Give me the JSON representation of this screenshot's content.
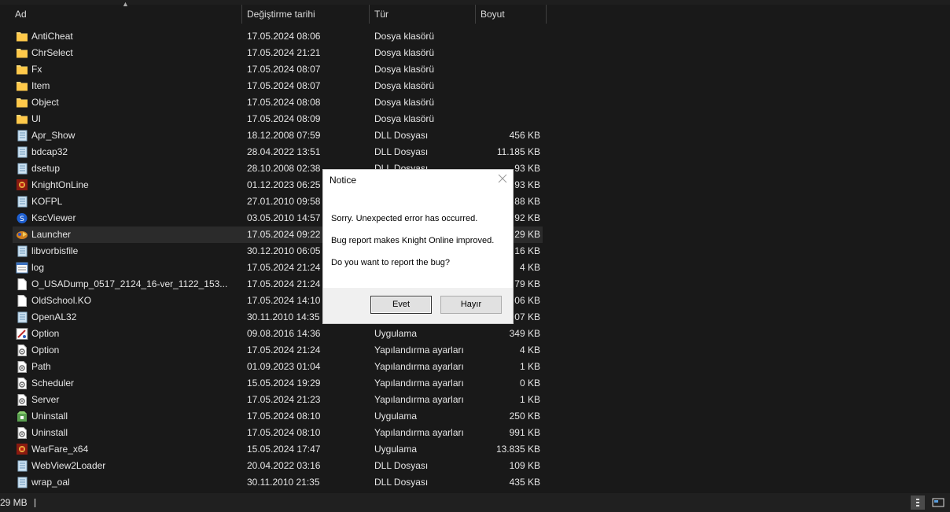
{
  "header": {
    "name": "Ad",
    "date": "Değiştirme tarihi",
    "type": "Tür",
    "size": "Boyut"
  },
  "files": [
    {
      "name": "AntiCheat",
      "date": "17.05.2024 08:06",
      "type": "Dosya klasörü",
      "size": "",
      "icon": "folder-icon"
    },
    {
      "name": "ChrSelect",
      "date": "17.05.2024 21:21",
      "type": "Dosya klasörü",
      "size": "",
      "icon": "folder-icon"
    },
    {
      "name": "Fx",
      "date": "17.05.2024 08:07",
      "type": "Dosya klasörü",
      "size": "",
      "icon": "folder-icon"
    },
    {
      "name": "Item",
      "date": "17.05.2024 08:07",
      "type": "Dosya klasörü",
      "size": "",
      "icon": "folder-icon"
    },
    {
      "name": "Object",
      "date": "17.05.2024 08:08",
      "type": "Dosya klasörü",
      "size": "",
      "icon": "folder-icon"
    },
    {
      "name": "UI",
      "date": "17.05.2024 08:09",
      "type": "Dosya klasörü",
      "size": "",
      "icon": "folder-icon"
    },
    {
      "name": "Apr_Show",
      "date": "18.12.2008 07:59",
      "type": "DLL Dosyası",
      "size": "456 KB",
      "icon": "dll-icon"
    },
    {
      "name": "bdcap32",
      "date": "28.04.2022 13:51",
      "type": "DLL Dosyası",
      "size": "11.185 KB",
      "icon": "dll-icon"
    },
    {
      "name": "dsetup",
      "date": "28.10.2008 02:38",
      "type": "DLL Dosyası",
      "size": "93 KB",
      "icon": "dll-icon"
    },
    {
      "name": "KnightOnLine",
      "date": "01.12.2023 06:25",
      "type": "",
      "size": "93 KB",
      "icon": "knightonline-app-icon"
    },
    {
      "name": "KOFPL",
      "date": "27.01.2010 09:58",
      "type": "",
      "size": "88 KB",
      "icon": "dll-icon"
    },
    {
      "name": "KscViewer",
      "date": "03.05.2010 14:57",
      "type": "",
      "size": "92 KB",
      "icon": "kscviewer-app-icon"
    },
    {
      "name": "Launcher",
      "date": "17.05.2024 09:22",
      "type": "",
      "size": "29 KB",
      "icon": "launcher-app-icon",
      "hover": true
    },
    {
      "name": "libvorbisfile",
      "date": "30.12.2010 06:05",
      "type": "",
      "size": "16 KB",
      "icon": "dll-icon"
    },
    {
      "name": "log",
      "date": "17.05.2024 21:24",
      "type": "",
      "size": "4 KB",
      "icon": "log-file-icon"
    },
    {
      "name": "O_USADump_0517_2124_16-ver_1122_153...",
      "date": "17.05.2024 21:24",
      "type": "",
      "size": "79 KB",
      "icon": "blank-file-icon"
    },
    {
      "name": "OldSchool.KO",
      "date": "17.05.2024 14:10",
      "type": "",
      "size": "06 KB",
      "icon": "blank-file-icon"
    },
    {
      "name": "OpenAL32",
      "date": "30.11.2010 14:35",
      "type": "",
      "size": "07 KB",
      "icon": "dll-icon"
    },
    {
      "name": "Option",
      "date": "09.08.2016 14:36",
      "type": "Uygulama",
      "size": "349 KB",
      "icon": "option-app-icon"
    },
    {
      "name": "Option",
      "date": "17.05.2024 21:24",
      "type": "Yapılandırma ayarları",
      "size": "4 KB",
      "icon": "config-file-icon"
    },
    {
      "name": "Path",
      "date": "01.09.2023 01:04",
      "type": "Yapılandırma ayarları",
      "size": "1 KB",
      "icon": "config-file-icon"
    },
    {
      "name": "Scheduler",
      "date": "15.05.2024 19:29",
      "type": "Yapılandırma ayarları",
      "size": "0 KB",
      "icon": "config-file-icon"
    },
    {
      "name": "Server",
      "date": "17.05.2024 21:23",
      "type": "Yapılandırma ayarları",
      "size": "1 KB",
      "icon": "config-file-icon"
    },
    {
      "name": "Uninstall",
      "date": "17.05.2024 08:10",
      "type": "Uygulama",
      "size": "250 KB",
      "icon": "uninstall-app-icon"
    },
    {
      "name": "Uninstall",
      "date": "17.05.2024 08:10",
      "type": "Yapılandırma ayarları",
      "size": "991 KB",
      "icon": "config-file-icon"
    },
    {
      "name": "WarFare_x64",
      "date": "15.05.2024 17:47",
      "type": "Uygulama",
      "size": "13.835 KB",
      "icon": "knightonline-app-icon"
    },
    {
      "name": "WebView2Loader",
      "date": "20.04.2022 03:16",
      "type": "DLL Dosyası",
      "size": "109 KB",
      "icon": "dll-icon"
    },
    {
      "name": "wrap_oal",
      "date": "30.11.2010 21:35",
      "type": "DLL Dosyası",
      "size": "435 KB",
      "icon": "dll-icon"
    }
  ],
  "status": {
    "text": "29 MB",
    "details_view_icon": "details-view-icon",
    "preview_view_icon": "preview-view-icon"
  },
  "dialog": {
    "title": "Notice",
    "line1": "Sorry. Unexpected error has occurred.",
    "line2": "Bug report makes Knight Online improved.",
    "line3": "Do you want to report the bug?",
    "yes_label": "Evet",
    "no_label": "Hayır"
  },
  "colors": {
    "background": "#191919",
    "text": "#e6e6e6",
    "folder": "#f8d775",
    "hover_row": "#2b2b2b"
  }
}
